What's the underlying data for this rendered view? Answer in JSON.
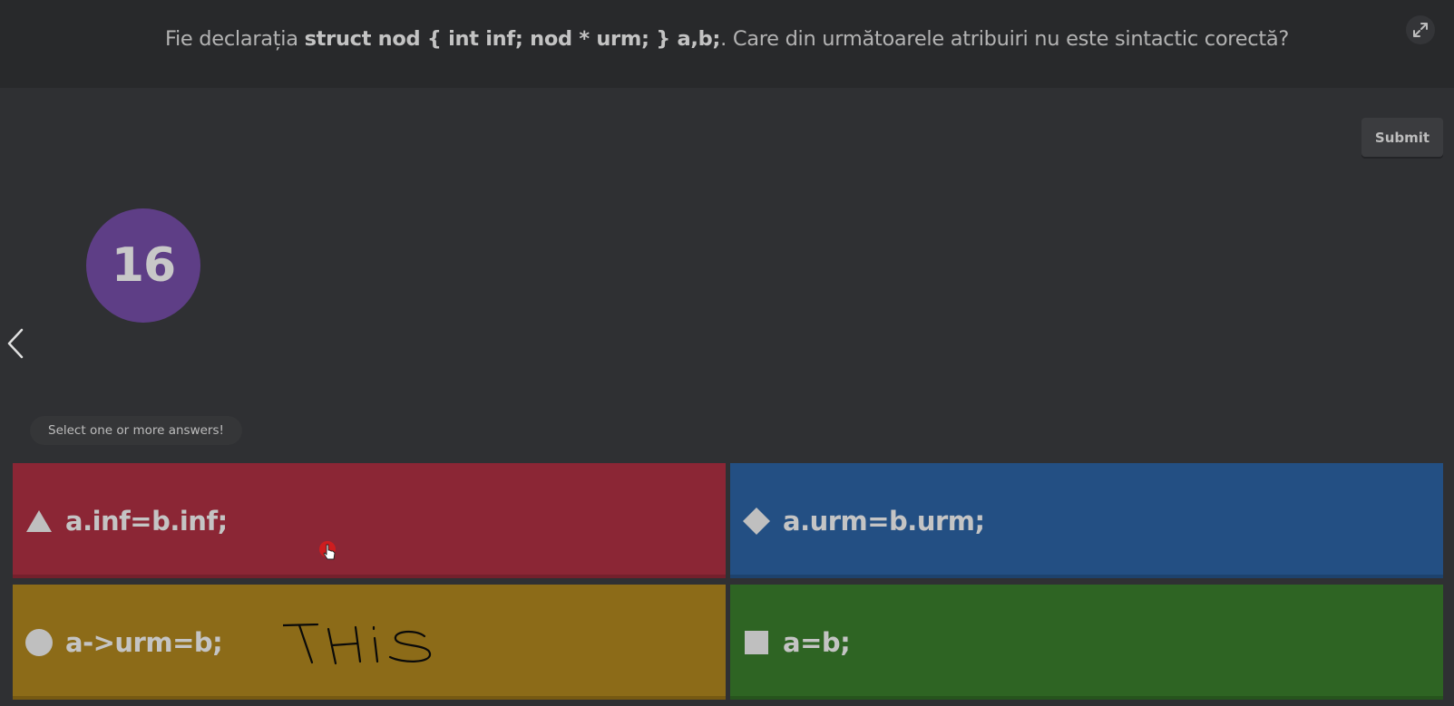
{
  "question": {
    "prefix": "Fie declarația ",
    "code": "struct nod { int inf; nod * urm; } a,b;",
    "suffix": ". Care din următoarele atribuiri nu este sintactic corectă?"
  },
  "submit_label": "Submit",
  "timer_value": "16",
  "hint": "Select one or more answers!",
  "options": [
    {
      "label": "a.inf=b.inf;",
      "shape": "triangle",
      "color": "#8b2635"
    },
    {
      "label": "a.urm=b.urm;",
      "shape": "diamond",
      "color": "#234f83"
    },
    {
      "label": "a->urm=b;",
      "shape": "circle",
      "color": "#8c6b18"
    },
    {
      "label": "a=b;",
      "shape": "square",
      "color": "#2e6423"
    }
  ],
  "annotation_text": "THIS",
  "icons": {
    "expand": "expand-icon",
    "prev": "chevron-left-icon",
    "cursor": "hand-pointer-icon"
  }
}
